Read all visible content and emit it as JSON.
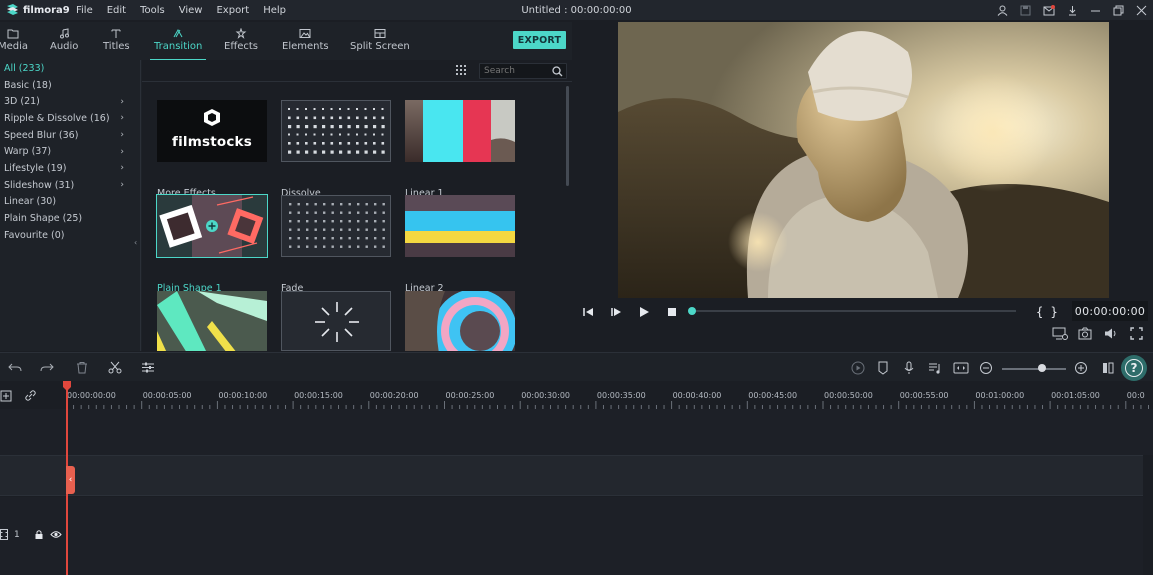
{
  "app": {
    "name": "filmora9",
    "title": "Untitled : 00:00:00:00",
    "menu": [
      "File",
      "Edit",
      "Tools",
      "View",
      "Export",
      "Help"
    ],
    "accent_color": "#4cd7c8"
  },
  "tabs": [
    {
      "label": "Media",
      "icon": "folder-icon"
    },
    {
      "label": "Audio",
      "icon": "music-note-icon"
    },
    {
      "label": "Titles",
      "icon": "text-icon"
    },
    {
      "label": "Transition",
      "icon": "transition-icon",
      "active": true
    },
    {
      "label": "Effects",
      "icon": "effects-icon"
    },
    {
      "label": "Elements",
      "icon": "image-icon"
    },
    {
      "label": "Split Screen",
      "icon": "split-screen-icon"
    }
  ],
  "export_label": "EXPORT",
  "categories": [
    {
      "label": "All (233)",
      "active": true,
      "expandable": false
    },
    {
      "label": "Basic (18)",
      "expandable": false
    },
    {
      "label": "3D (21)",
      "expandable": true
    },
    {
      "label": "Ripple & Dissolve (16)",
      "expandable": true
    },
    {
      "label": "Speed Blur (36)",
      "expandable": true
    },
    {
      "label": "Warp (37)",
      "expandable": true
    },
    {
      "label": "Lifestyle (19)",
      "expandable": true
    },
    {
      "label": "Slideshow (31)",
      "expandable": true
    },
    {
      "label": "Linear (30)",
      "expandable": false
    },
    {
      "label": "Plain Shape (25)",
      "expandable": false
    },
    {
      "label": "Favourite (0)",
      "expandable": false
    }
  ],
  "search": {
    "placeholder": "Search"
  },
  "thumbnails": [
    {
      "label": "More Effects",
      "brand": "filmstocks"
    },
    {
      "label": "Dissolve"
    },
    {
      "label": "Linear 1"
    },
    {
      "label": "Plain Shape 1",
      "selected": true
    },
    {
      "label": "Fade"
    },
    {
      "label": "Linear 2"
    },
    {
      "label": ""
    },
    {
      "label": ""
    },
    {
      "label": ""
    }
  ],
  "preview": {
    "timecode": "00:00:00:00",
    "progress": 0.0
  },
  "timeline": {
    "ruler": [
      "00:00:00:00",
      "00:00:05:00",
      "00:00:10:00",
      "00:00:15:00",
      "00:00:20:00",
      "00:00:25:00",
      "00:00:30:00",
      "00:00:35:00",
      "00:00:40:00",
      "00:00:45:00",
      "00:00:50:00",
      "00:00:55:00",
      "00:01:00:00",
      "00:01:05:00",
      "00:0"
    ],
    "track_label": "1"
  }
}
